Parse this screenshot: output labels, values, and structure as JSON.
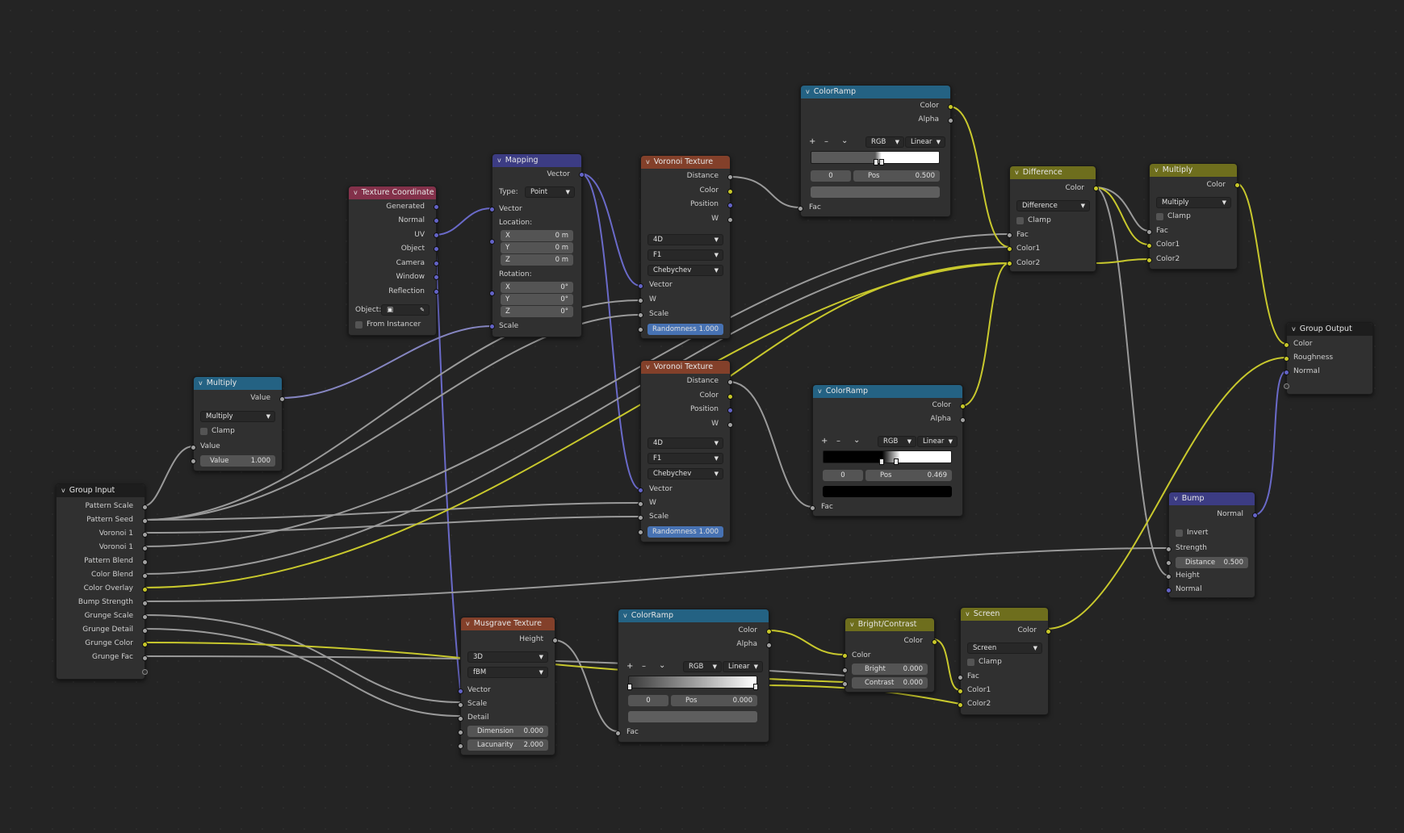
{
  "nodes": {
    "tex_coord": {
      "title": "Texture Coordinate",
      "outputs": [
        "Generated",
        "Normal",
        "UV",
        "Object",
        "Camera",
        "Window",
        "Reflection"
      ],
      "object_label": "Object:",
      "from_instancer": "From Instancer"
    },
    "mapping": {
      "title": "Mapping",
      "output": "Vector",
      "type_label": "Type:",
      "type_value": "Point",
      "vector": "Vector",
      "location": "Location:",
      "loc": [
        {
          "a": "X",
          "v": "0 m"
        },
        {
          "a": "Y",
          "v": "0 m"
        },
        {
          "a": "Z",
          "v": "0 m"
        }
      ],
      "rotation": "Rotation:",
      "rot": [
        {
          "a": "X",
          "v": "0°"
        },
        {
          "a": "Y",
          "v": "0°"
        },
        {
          "a": "Z",
          "v": "0°"
        }
      ],
      "scale": "Scale"
    },
    "voronoi1": {
      "title": "Voronoi Texture",
      "outputs": [
        "Distance",
        "Color",
        "Position",
        "W"
      ],
      "dims": "4D",
      "feature": "F1",
      "metric": "Chebychev",
      "inputs": [
        "Vector",
        "W",
        "Scale"
      ],
      "rand_label": "Randomness",
      "rand_value": "1.000"
    },
    "voronoi2": {
      "title": "Voronoi Texture",
      "outputs": [
        "Distance",
        "Color",
        "Position",
        "W"
      ],
      "dims": "4D",
      "feature": "F1",
      "metric": "Chebychev",
      "inputs": [
        "Vector",
        "W",
        "Scale"
      ],
      "rand_label": "Randomness",
      "rand_value": "1.000"
    },
    "ramp_top": {
      "title": "ColorRamp",
      "outputs": [
        "Color",
        "Alpha"
      ],
      "mode": "RGB",
      "interp": "Linear",
      "index": "0",
      "pos_label": "Pos",
      "pos_value": "0.500",
      "fac": "Fac"
    },
    "ramp_mid": {
      "title": "ColorRamp",
      "outputs": [
        "Color",
        "Alpha"
      ],
      "mode": "RGB",
      "interp": "Linear",
      "index": "0",
      "pos_label": "Pos",
      "pos_value": "0.469",
      "fac": "Fac"
    },
    "ramp_bot": {
      "title": "ColorRamp",
      "outputs": [
        "Color",
        "Alpha"
      ],
      "mode": "RGB",
      "interp": "Linear",
      "index": "0",
      "pos_label": "Pos",
      "pos_value": "0.000",
      "fac": "Fac"
    },
    "multiply_left": {
      "title": "Multiply",
      "output": "Value",
      "op": "Multiply",
      "clamp": "Clamp",
      "input": "Value",
      "value_label": "Value",
      "value": "1.000"
    },
    "group_input": {
      "title": "Group Input",
      "outputs": [
        "Pattern Scale",
        "Pattern Seed",
        "Voronoi 1",
        "Voronoi 1",
        "Pattern Blend",
        "Color Blend",
        "Color Overlay",
        "Bump Strength",
        "Grunge Scale",
        "Grunge Detail",
        "Grunge Color",
        "Grunge Fac"
      ]
    },
    "musgrave": {
      "title": "Musgrave Texture",
      "output": "Height",
      "dims": "3D",
      "type": "fBM",
      "inputs": [
        "Vector",
        "Scale",
        "Detail"
      ],
      "dim_label": "Dimension",
      "dim_value": "0.000",
      "lac_label": "Lacunarity",
      "lac_value": "2.000"
    },
    "difference": {
      "title": "Difference",
      "output": "Color",
      "op": "Difference",
      "clamp": "Clamp",
      "inputs": [
        "Fac",
        "Color1",
        "Color2"
      ]
    },
    "multiply_right": {
      "title": "Multiply",
      "output": "Color",
      "op": "Multiply",
      "clamp": "Clamp",
      "inputs": [
        "Fac",
        "Color1",
        "Color2"
      ]
    },
    "group_output": {
      "title": "Group Output",
      "inputs": [
        "Color",
        "Roughness",
        "Normal"
      ]
    },
    "bump": {
      "title": "Bump",
      "output": "Normal",
      "invert": "Invert",
      "strength": "Strength",
      "dist_label": "Distance",
      "dist_value": "0.500",
      "height": "Height",
      "normal": "Normal"
    },
    "bright_contrast": {
      "title": "Bright/Contrast",
      "output": "Color",
      "color": "Color",
      "bright_label": "Bright",
      "bright_value": "0.000",
      "contrast_label": "Contrast",
      "contrast_value": "0.000"
    },
    "screen": {
      "title": "Screen",
      "output": "Color",
      "op": "Screen",
      "clamp": "Clamp",
      "inputs": [
        "Fac",
        "Color1",
        "Color2"
      ]
    }
  },
  "colors": {
    "socket_gray": "#a1a1a1",
    "socket_yellow": "#c7c729",
    "socket_purple": "#6363c7",
    "header_input": "#83314a",
    "header_vector": "#3c3c83",
    "header_texture": "#83402a",
    "header_converter": "#246283",
    "header_color": "#6e6e1d",
    "header_group": "#1d1d1d"
  }
}
